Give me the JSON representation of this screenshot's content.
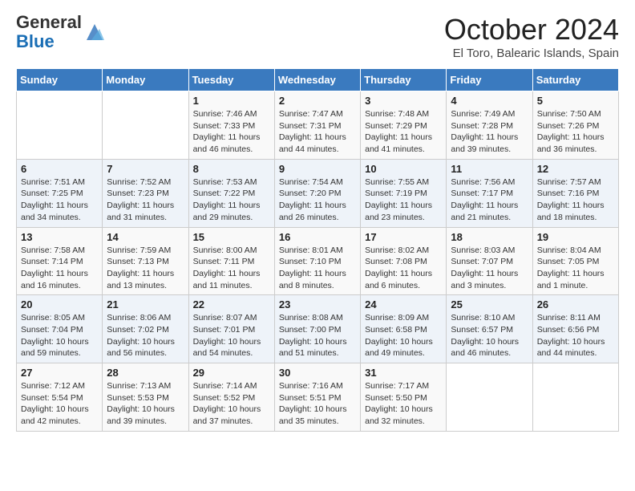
{
  "logo": {
    "general": "General",
    "blue": "Blue"
  },
  "header": {
    "month": "October 2024",
    "location": "El Toro, Balearic Islands, Spain"
  },
  "days_of_week": [
    "Sunday",
    "Monday",
    "Tuesday",
    "Wednesday",
    "Thursday",
    "Friday",
    "Saturday"
  ],
  "weeks": [
    [
      {
        "day": "",
        "info": ""
      },
      {
        "day": "",
        "info": ""
      },
      {
        "day": "1",
        "info": "Sunrise: 7:46 AM\nSunset: 7:33 PM\nDaylight: 11 hours and 46 minutes."
      },
      {
        "day": "2",
        "info": "Sunrise: 7:47 AM\nSunset: 7:31 PM\nDaylight: 11 hours and 44 minutes."
      },
      {
        "day": "3",
        "info": "Sunrise: 7:48 AM\nSunset: 7:29 PM\nDaylight: 11 hours and 41 minutes."
      },
      {
        "day": "4",
        "info": "Sunrise: 7:49 AM\nSunset: 7:28 PM\nDaylight: 11 hours and 39 minutes."
      },
      {
        "day": "5",
        "info": "Sunrise: 7:50 AM\nSunset: 7:26 PM\nDaylight: 11 hours and 36 minutes."
      }
    ],
    [
      {
        "day": "6",
        "info": "Sunrise: 7:51 AM\nSunset: 7:25 PM\nDaylight: 11 hours and 34 minutes."
      },
      {
        "day": "7",
        "info": "Sunrise: 7:52 AM\nSunset: 7:23 PM\nDaylight: 11 hours and 31 minutes."
      },
      {
        "day": "8",
        "info": "Sunrise: 7:53 AM\nSunset: 7:22 PM\nDaylight: 11 hours and 29 minutes."
      },
      {
        "day": "9",
        "info": "Sunrise: 7:54 AM\nSunset: 7:20 PM\nDaylight: 11 hours and 26 minutes."
      },
      {
        "day": "10",
        "info": "Sunrise: 7:55 AM\nSunset: 7:19 PM\nDaylight: 11 hours and 23 minutes."
      },
      {
        "day": "11",
        "info": "Sunrise: 7:56 AM\nSunset: 7:17 PM\nDaylight: 11 hours and 21 minutes."
      },
      {
        "day": "12",
        "info": "Sunrise: 7:57 AM\nSunset: 7:16 PM\nDaylight: 11 hours and 18 minutes."
      }
    ],
    [
      {
        "day": "13",
        "info": "Sunrise: 7:58 AM\nSunset: 7:14 PM\nDaylight: 11 hours and 16 minutes."
      },
      {
        "day": "14",
        "info": "Sunrise: 7:59 AM\nSunset: 7:13 PM\nDaylight: 11 hours and 13 minutes."
      },
      {
        "day": "15",
        "info": "Sunrise: 8:00 AM\nSunset: 7:11 PM\nDaylight: 11 hours and 11 minutes."
      },
      {
        "day": "16",
        "info": "Sunrise: 8:01 AM\nSunset: 7:10 PM\nDaylight: 11 hours and 8 minutes."
      },
      {
        "day": "17",
        "info": "Sunrise: 8:02 AM\nSunset: 7:08 PM\nDaylight: 11 hours and 6 minutes."
      },
      {
        "day": "18",
        "info": "Sunrise: 8:03 AM\nSunset: 7:07 PM\nDaylight: 11 hours and 3 minutes."
      },
      {
        "day": "19",
        "info": "Sunrise: 8:04 AM\nSunset: 7:05 PM\nDaylight: 11 hours and 1 minute."
      }
    ],
    [
      {
        "day": "20",
        "info": "Sunrise: 8:05 AM\nSunset: 7:04 PM\nDaylight: 10 hours and 59 minutes."
      },
      {
        "day": "21",
        "info": "Sunrise: 8:06 AM\nSunset: 7:02 PM\nDaylight: 10 hours and 56 minutes."
      },
      {
        "day": "22",
        "info": "Sunrise: 8:07 AM\nSunset: 7:01 PM\nDaylight: 10 hours and 54 minutes."
      },
      {
        "day": "23",
        "info": "Sunrise: 8:08 AM\nSunset: 7:00 PM\nDaylight: 10 hours and 51 minutes."
      },
      {
        "day": "24",
        "info": "Sunrise: 8:09 AM\nSunset: 6:58 PM\nDaylight: 10 hours and 49 minutes."
      },
      {
        "day": "25",
        "info": "Sunrise: 8:10 AM\nSunset: 6:57 PM\nDaylight: 10 hours and 46 minutes."
      },
      {
        "day": "26",
        "info": "Sunrise: 8:11 AM\nSunset: 6:56 PM\nDaylight: 10 hours and 44 minutes."
      }
    ],
    [
      {
        "day": "27",
        "info": "Sunrise: 7:12 AM\nSunset: 5:54 PM\nDaylight: 10 hours and 42 minutes."
      },
      {
        "day": "28",
        "info": "Sunrise: 7:13 AM\nSunset: 5:53 PM\nDaylight: 10 hours and 39 minutes."
      },
      {
        "day": "29",
        "info": "Sunrise: 7:14 AM\nSunset: 5:52 PM\nDaylight: 10 hours and 37 minutes."
      },
      {
        "day": "30",
        "info": "Sunrise: 7:16 AM\nSunset: 5:51 PM\nDaylight: 10 hours and 35 minutes."
      },
      {
        "day": "31",
        "info": "Sunrise: 7:17 AM\nSunset: 5:50 PM\nDaylight: 10 hours and 32 minutes."
      },
      {
        "day": "",
        "info": ""
      },
      {
        "day": "",
        "info": ""
      }
    ]
  ]
}
